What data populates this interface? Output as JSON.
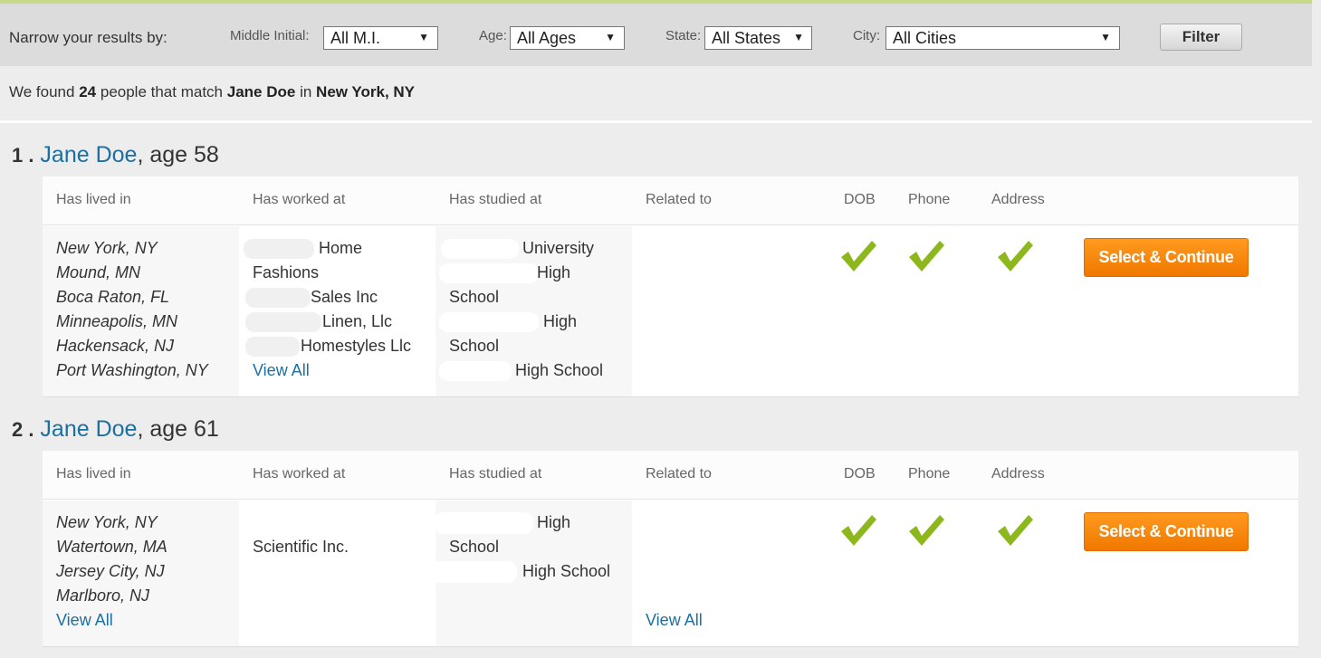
{
  "filters": {
    "narrow_label": "Narrow your results by:",
    "middle_initial_label": "Middle Initial:",
    "middle_initial_value": "All M.I.",
    "age_label": "Age:",
    "age_value": "All Ages",
    "state_label": "State:",
    "state_value": "All States",
    "city_label": "City:",
    "city_value": "All Cities",
    "filter_button": "Filter"
  },
  "summary": {
    "prefix": "We found",
    "count": "24",
    "middle": "people that match",
    "query_name": "Jane Doe",
    "in": "in",
    "location": "New York, NY"
  },
  "columns": {
    "lived": "Has lived in",
    "worked": "Has worked at",
    "studied": "Has studied at",
    "related": "Related to",
    "dob": "DOB",
    "phone": "Phone",
    "address": "Address"
  },
  "select_label": "Select & Continue",
  "results": [
    {
      "index": "1 .",
      "name": "Jane Doe",
      "age": ", age 58",
      "lived": [
        "New York, NY",
        "Mound, MN",
        "Boca Raton, FL",
        "Minneapolis, MN",
        "Hackensack, NJ",
        "Port Washington, NY"
      ],
      "worked": [
        "Home",
        "Fashions",
        "Sales Inc",
        "Linen, Llc",
        "Homestyles Llc"
      ],
      "worked_view_all": "View All",
      "studied": [
        "University",
        "High",
        "School",
        "High",
        "School",
        "High School"
      ]
    },
    {
      "index": "2 .",
      "name": "Jane Doe",
      "age": ", age 61",
      "lived": [
        "New York, NY",
        "Watertown, MA",
        "Jersey City, NJ",
        "Marlboro, NJ"
      ],
      "lived_view_all": "View All",
      "worked": [
        "Scientific Inc."
      ],
      "studied": [
        "High",
        "School",
        "High School"
      ],
      "related_view_all": "View All"
    }
  ],
  "colors": {
    "accent_link": "#1c6fa0",
    "button_orange": "#f58a0b",
    "check_green": "#8db81d"
  }
}
